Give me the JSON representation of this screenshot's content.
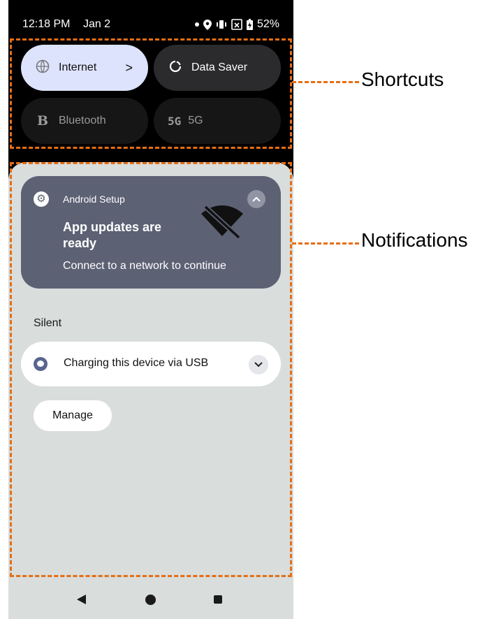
{
  "status_bar": {
    "time": "12:18 PM",
    "date": "Jan 2",
    "battery": "52%"
  },
  "quick_settings": {
    "tiles": [
      {
        "label": "Internet",
        "icon": "wifi-unknown-icon",
        "state": "active",
        "chevron": ">"
      },
      {
        "label": "Data Saver",
        "icon": "data-saver-icon",
        "state": "off"
      },
      {
        "label": "Bluetooth",
        "icon": "bluetooth-icon",
        "icon_glyph": "B",
        "state": "unavailable"
      },
      {
        "label": "5G",
        "icon": "5g-icon",
        "icon_glyph": "5G",
        "state": "unavailable"
      }
    ]
  },
  "notifications": {
    "setup_card": {
      "app_name": "Android Setup",
      "title": "App updates are ready",
      "text": "Connect to a network to continue"
    },
    "section_label": "Silent",
    "usb_card": {
      "label": "Charging this device via USB"
    },
    "manage_button": "Manage"
  },
  "annotations": {
    "shortcuts": "Shortcuts",
    "notifications": "Notifications",
    "color": "#e66e13"
  },
  "colors": {
    "accent_tile": "#dde3fc",
    "notification_card": "#5d6174",
    "shade_bg": "#d9dddc"
  }
}
